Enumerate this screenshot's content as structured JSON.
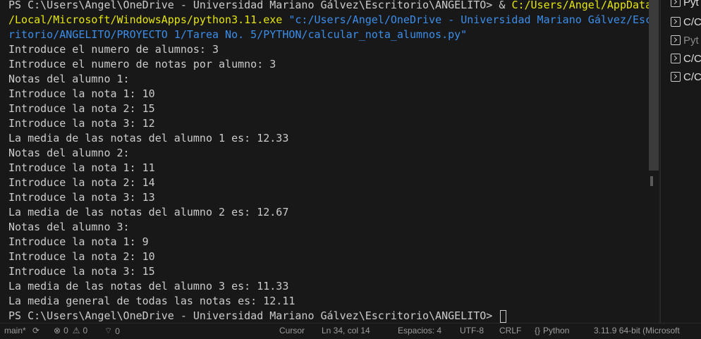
{
  "terminal": {
    "lines": [
      {
        "text": "PS C:\\Users\\Angel\\OneDrive - Universidad Mariano Gálvez\\Escritorio\\ANGELITO> & ",
        "cmd": "C:/Users/Angel/AppData"
      },
      {
        "cmd": "/Local/Microsoft/WindowsApps/python3.11.exe",
        "str": " \"c:/Users/Angel/OneDrive - Universidad Mariano Gálvez/Esc"
      },
      {
        "str": "ritorio/ANGELITO/PROYECTO 1/Tarea No. 5/PYTHON/calcular_nota_alumnos.py\""
      },
      {
        "text": "Introduce el numero de alumnos: 3"
      },
      {
        "text": "Introduce el numero de notas por alumno: 3"
      },
      {
        "text": "Notas del alumno 1:"
      },
      {
        "text": "Introduce la nota 1: 10"
      },
      {
        "text": "Introduce la nota 2: 15"
      },
      {
        "text": "Introduce la nota 3: 12"
      },
      {
        "text": "La media de las notas del alumno 1 es: 12.33"
      },
      {
        "text": "Notas del alumno 2:"
      },
      {
        "text": "Introduce la nota 1: 11"
      },
      {
        "text": "Introduce la nota 2: 14"
      },
      {
        "text": "Introduce la nota 3: 13"
      },
      {
        "text": "La media de las notas del alumno 2 es: 12.67"
      },
      {
        "text": "Notas del alumno 3:"
      },
      {
        "text": "Introduce la nota 1: 9"
      },
      {
        "text": "Introduce la nota 2: 10"
      },
      {
        "text": "Introduce la nota 3: 15"
      },
      {
        "text": "La media de las notas del alumno 3 es: 11.33"
      },
      {
        "text": "La media general de todas las notas es: 12.11"
      },
      {
        "text": "PS C:\\Users\\Angel\\OneDrive - Universidad Mariano Gálvez\\Escritorio\\ANGELITO> ",
        "cursor": true
      }
    ]
  },
  "terminal_tabs": [
    {
      "label": "Pyt",
      "dim": false
    },
    {
      "label": "C/C",
      "dim": false
    },
    {
      "label": "Pyt",
      "dim": true
    },
    {
      "label": "C/C",
      "dim": false
    },
    {
      "label": "C/C",
      "dim": false
    }
  ],
  "statusbar": {
    "branch": "main*",
    "sync_icon": "sync-icon",
    "errors": "0",
    "warnings": "0",
    "ports": "0",
    "cursor": "Cursor",
    "position": "Ln 34, col 14",
    "spaces": "Espacios: 4",
    "encoding": "UTF-8",
    "eol": "CRLF",
    "language": "Python",
    "interpreter": "3.11.9 64-bit (Microsoft"
  },
  "colors": {
    "terminal_bg": "#181818",
    "text": "#cccccc",
    "command": "#e5e510",
    "string": "#3b8eea"
  }
}
